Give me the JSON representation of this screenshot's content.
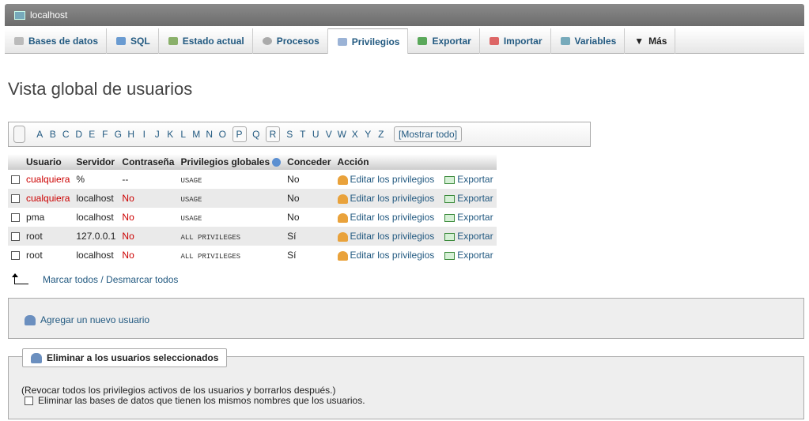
{
  "server": {
    "title": "localhost"
  },
  "tabs": [
    {
      "label": "Bases de datos"
    },
    {
      "label": "SQL"
    },
    {
      "label": "Estado actual"
    },
    {
      "label": "Procesos"
    },
    {
      "label": "Privilegios"
    },
    {
      "label": "Exportar"
    },
    {
      "label": "Importar"
    },
    {
      "label": "Variables"
    },
    {
      "label": "Más"
    }
  ],
  "page_title": "Vista global de usuarios",
  "letters": [
    "A",
    "B",
    "C",
    "D",
    "E",
    "F",
    "G",
    "H",
    "I",
    "J",
    "K",
    "L",
    "M",
    "N",
    "O",
    "P",
    "Q",
    "R",
    "S",
    "T",
    "U",
    "V",
    "W",
    "X",
    "Y",
    "Z"
  ],
  "show_all": "[Mostrar todo]",
  "table": {
    "headers": [
      "Usuario",
      "Servidor",
      "Contraseña",
      "Privilegios globales",
      "Conceder",
      "Acción"
    ],
    "rows": [
      {
        "user": "cualquiera",
        "host": "%",
        "password": "--",
        "priv": "USAGE",
        "grant": "No"
      },
      {
        "user": "cualquiera",
        "host": "localhost",
        "password": "No",
        "priv": "USAGE",
        "grant": "No"
      },
      {
        "user": "pma",
        "host": "localhost",
        "password": "No",
        "priv": "USAGE",
        "grant": "No"
      },
      {
        "user": "root",
        "host": "127.0.0.1",
        "password": "No",
        "priv": "ALL PRIVILEGES",
        "grant": "Sí"
      },
      {
        "user": "root",
        "host": "localhost",
        "password": "No",
        "priv": "ALL PRIVILEGES",
        "grant": "Sí"
      }
    ],
    "edit_label": "Editar los privilegios",
    "export_label": "Exportar"
  },
  "mark_all": "Marcar todos / Desmarcar todos",
  "add_user": "Agregar un nuevo usuario",
  "delete": {
    "legend": "Eliminar a los usuarios seleccionados",
    "note": "(Revocar todos los privilegios activos de los usuarios y borrarlos después.)",
    "drop_db": "Eliminar las bases de datos que tienen los mismos nombres que los usuarios."
  }
}
